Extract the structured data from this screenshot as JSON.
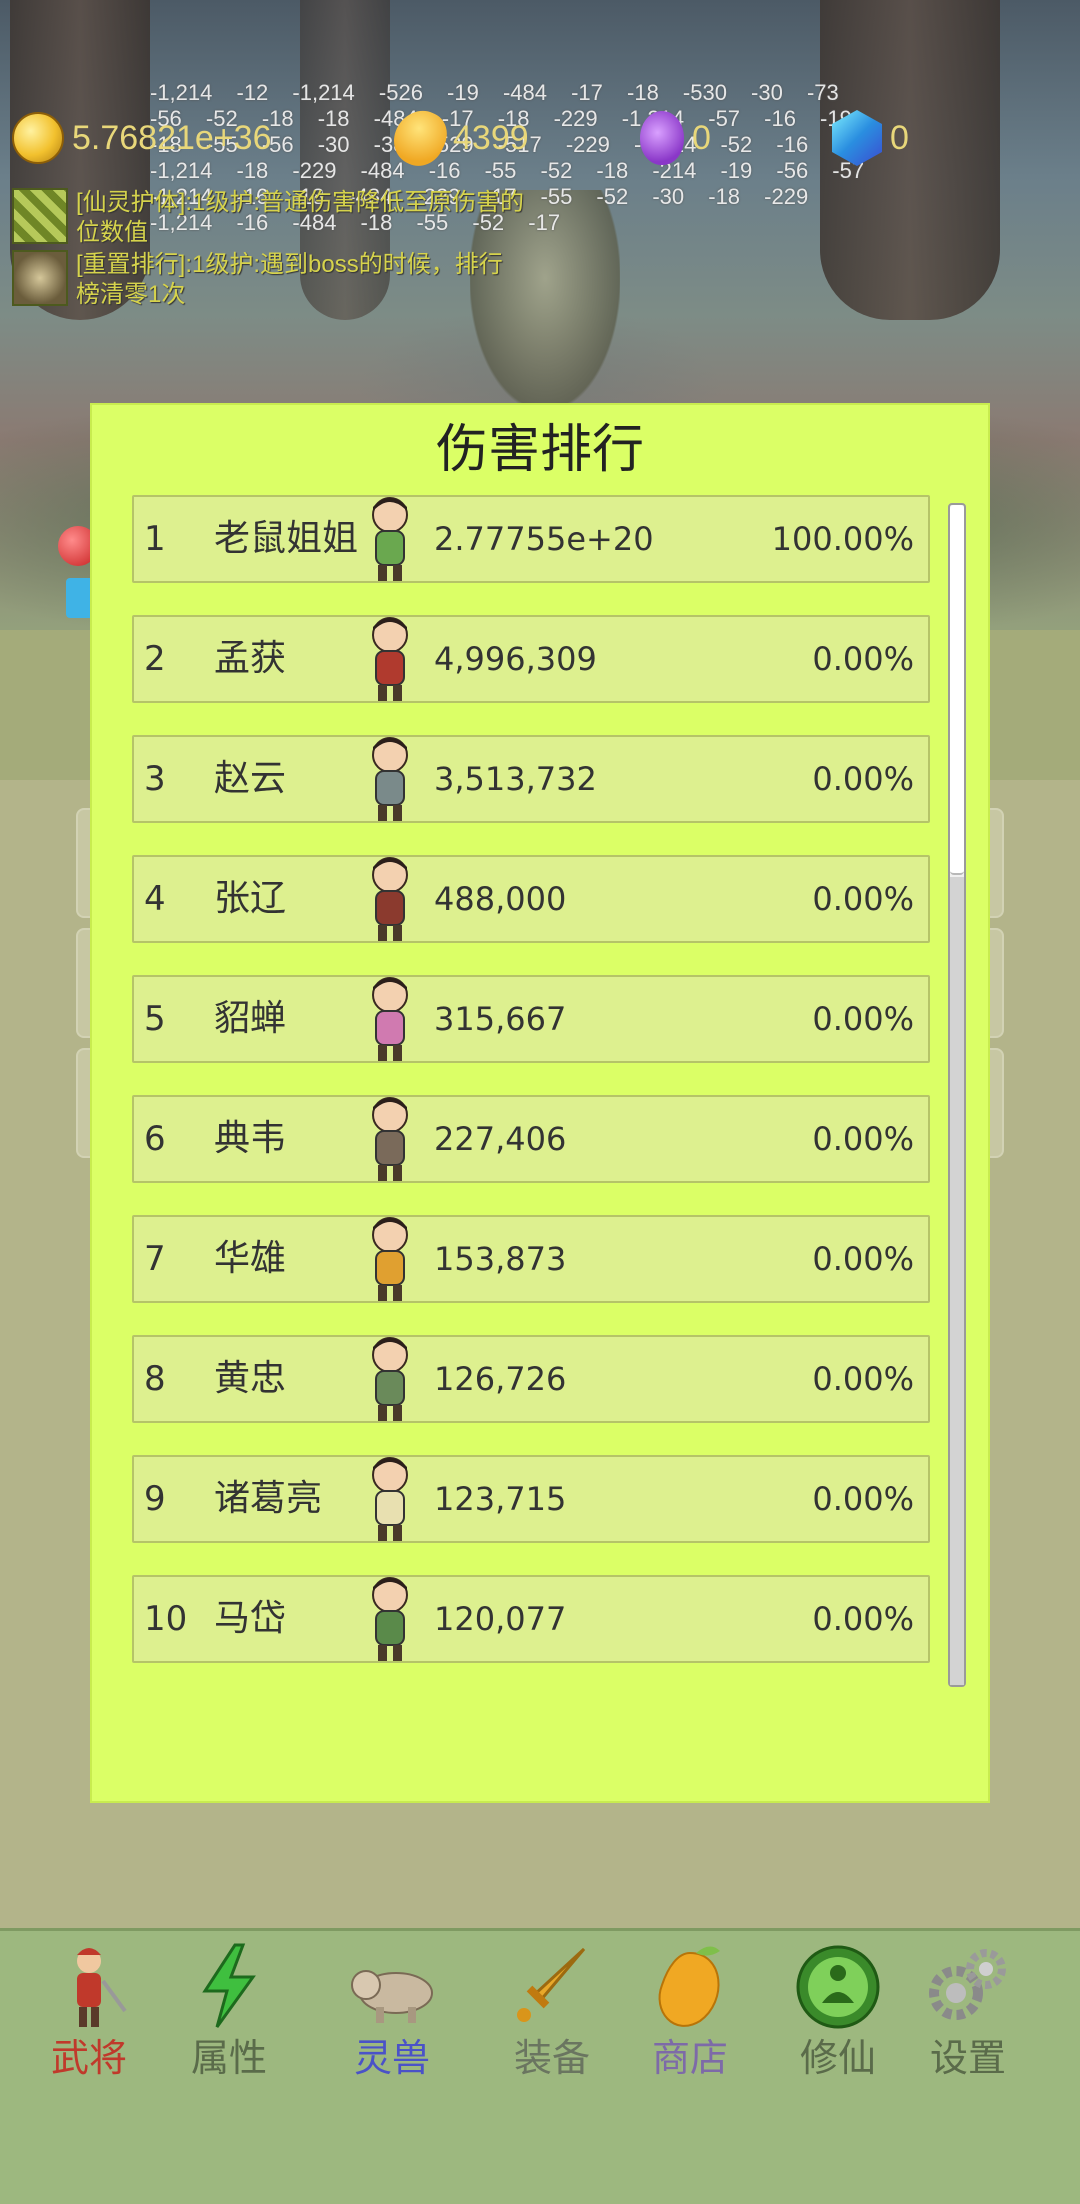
{
  "resources": {
    "gold": "5.76821e+36",
    "mango": "4399",
    "potion": "0",
    "gem": "0"
  },
  "buffs": [
    {
      "line1": "[仙灵护体]:1级护:普通伤害降低至原伤害的",
      "line2": "位数值"
    },
    {
      "line1": "[重置排行]:1级护:遇到boss的时候，排行",
      "line2": "榜清零1次"
    }
  ],
  "damage_numbers": "-1,214 -12 -1,214 -526 -19 -484 -17 -18 -530 -30 -73 -56 -52 -18 -18 -484 -17 -18 -229 -1,214 -57 -16 -19 -18 -55 -56 -30 -38 -529 -517 -229 -1,214 -52 -16 -1,214 -18 -229 -484 -16 -55 -52 -18 -214 -19 -56 -57 -1,214 -16 -18 -484 -229 -17 -55 -52 -30 -18 -229 -1,214 -16 -484 -18 -55 -52 -17",
  "dialog": {
    "title": "伤害排行",
    "rows": [
      {
        "rank": "1",
        "name": "老鼠姐姐",
        "damage": "2.77755e+20",
        "percent": "100.00%"
      },
      {
        "rank": "2",
        "name": "孟获",
        "damage": "4,996,309",
        "percent": "0.00%"
      },
      {
        "rank": "3",
        "name": "赵云",
        "damage": "3,513,732",
        "percent": "0.00%"
      },
      {
        "rank": "4",
        "name": "张辽",
        "damage": "488,000",
        "percent": "0.00%"
      },
      {
        "rank": "5",
        "name": "貂蝉",
        "damage": "315,667",
        "percent": "0.00%"
      },
      {
        "rank": "6",
        "name": "典韦",
        "damage": "227,406",
        "percent": "0.00%"
      },
      {
        "rank": "7",
        "name": "华雄",
        "damage": "153,873",
        "percent": "0.00%"
      },
      {
        "rank": "8",
        "name": "黄忠",
        "damage": "126,726",
        "percent": "0.00%"
      },
      {
        "rank": "9",
        "name": "诸葛亮",
        "damage": "123,715",
        "percent": "0.00%"
      },
      {
        "rank": "10",
        "name": "马岱",
        "damage": "120,077",
        "percent": "0.00%"
      }
    ]
  },
  "nav": [
    {
      "label": "武将",
      "color": "#c0392b",
      "icon": "general-icon"
    },
    {
      "label": "属性",
      "color": "#5a6b4a",
      "icon": "lightning-icon"
    },
    {
      "label": "灵兽",
      "color": "#4a52c8",
      "icon": "beast-icon"
    },
    {
      "label": "装备",
      "color": "#6a7560",
      "icon": "sword-icon"
    },
    {
      "label": "商店",
      "color": "#7d6aa8",
      "icon": "mango-icon"
    },
    {
      "label": "修仙",
      "color": "#5a6b4a",
      "icon": "meditation-icon"
    },
    {
      "label": "设置",
      "color": "#5a6b4a",
      "icon": "gear-icon"
    }
  ]
}
